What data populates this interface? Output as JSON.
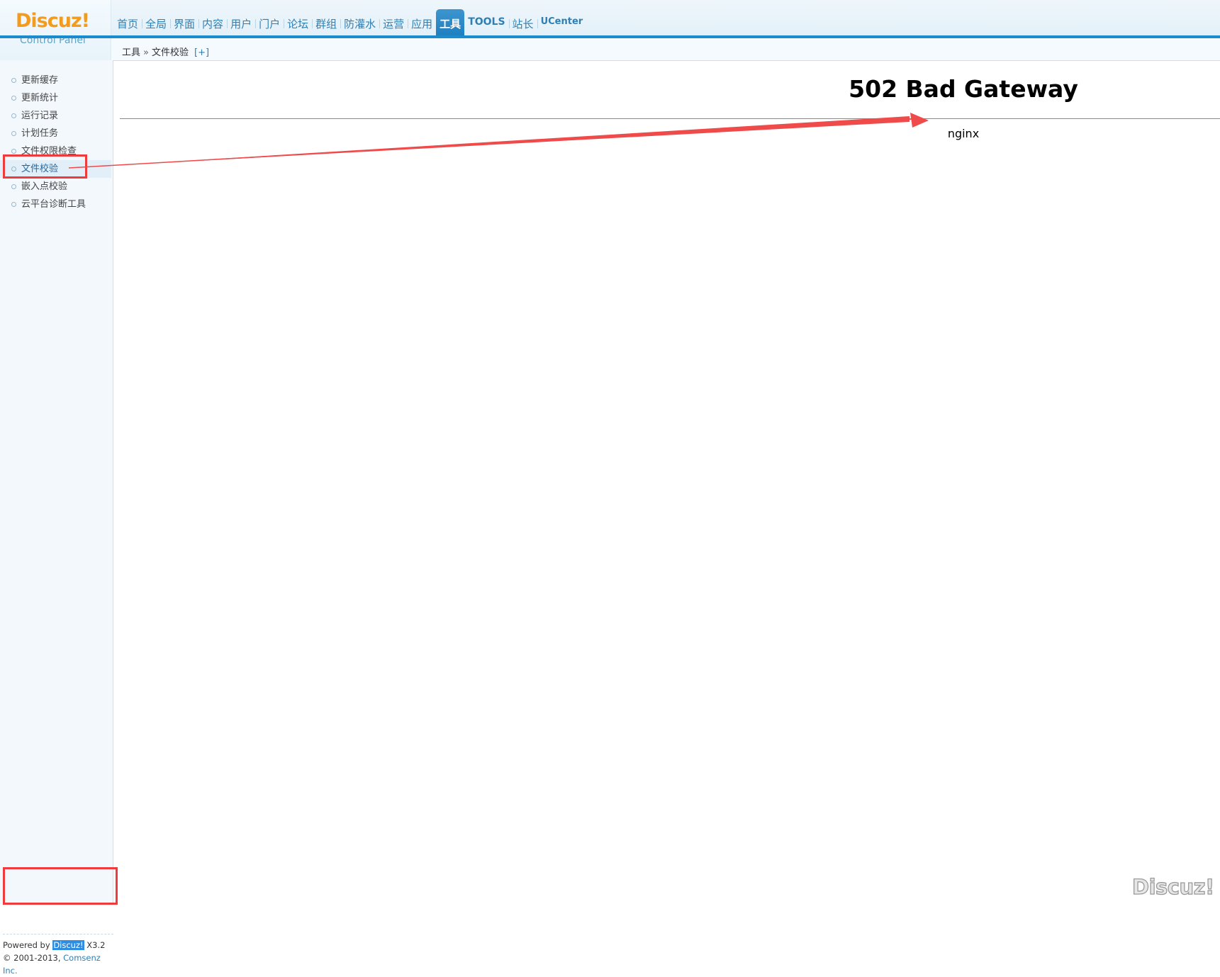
{
  "logo": {
    "word": "Discuz!",
    "sub": "Control Panel"
  },
  "nav": {
    "items": [
      "首页",
      "全局",
      "界面",
      "内容",
      "用户",
      "门户",
      "论坛",
      "群组",
      "防灌水",
      "运营",
      "应用",
      "工具",
      "TOOLS",
      "站长",
      "UCenter"
    ],
    "active": "工具"
  },
  "breadcrumb": {
    "section": "工具",
    "separator": "»",
    "page": "文件校验",
    "add": "[+]"
  },
  "sidebar": {
    "items": [
      "更新缓存",
      "更新统计",
      "运行记录",
      "计划任务",
      "文件权限检查",
      "文件校验",
      "嵌入点校验",
      "云平台诊断工具"
    ],
    "active": "文件校验",
    "footer": {
      "powered_by": "Powered by",
      "brand": "Discuz!",
      "version": "X3.2",
      "copyright": "© 2001-2013,",
      "company": "Comsenz Inc."
    }
  },
  "error": {
    "title": "502 Bad Gateway",
    "server": "nginx"
  },
  "watermark": "Discuz!",
  "colors": {
    "accent": "#1b8bcd",
    "logo": "#f39b1f",
    "annotation": "#ef3b3b"
  }
}
